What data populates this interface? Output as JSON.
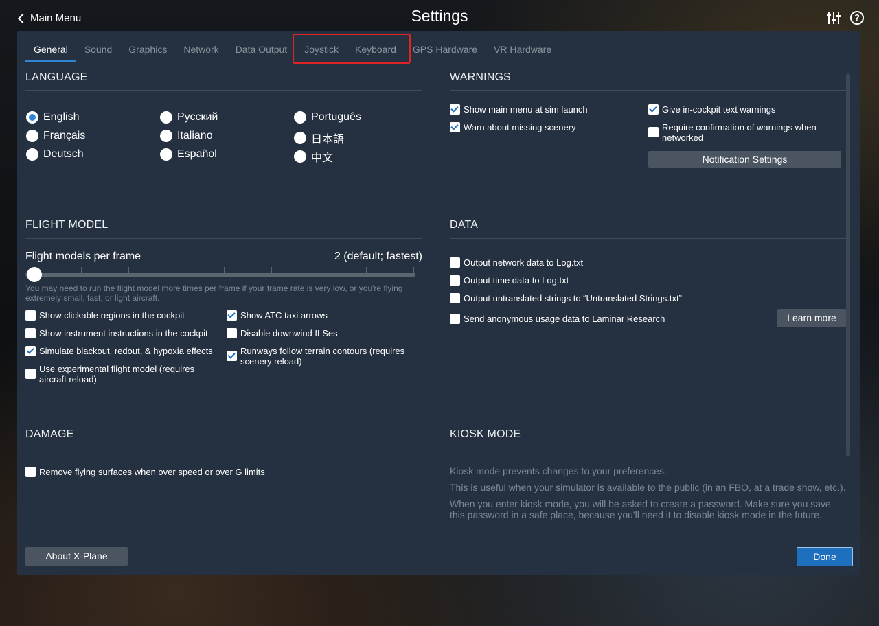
{
  "topbar": {
    "back_label": "Main Menu",
    "title": "Settings"
  },
  "tabs": [
    {
      "label": "General"
    },
    {
      "label": "Sound"
    },
    {
      "label": "Graphics"
    },
    {
      "label": "Network"
    },
    {
      "label": "Data Output"
    },
    {
      "label": "Joystick"
    },
    {
      "label": "Keyboard"
    },
    {
      "label": "GPS Hardware"
    },
    {
      "label": "VR Hardware"
    }
  ],
  "language": {
    "title": "LANGUAGE",
    "options": [
      "English",
      "Français",
      "Deutsch",
      "Русский",
      "Italiano",
      "Español",
      "Português",
      "日本語",
      "中文"
    ],
    "selected": "English"
  },
  "warnings": {
    "title": "WARNINGS",
    "items": [
      {
        "label": "Show main menu at sim launch",
        "checked": true
      },
      {
        "label": "Warn about missing scenery",
        "checked": true
      },
      {
        "label": "Give in-cockpit text warnings",
        "checked": true
      },
      {
        "label": "Require confirmation of warnings when networked",
        "checked": false
      }
    ],
    "notification_button": "Notification Settings"
  },
  "flight_model": {
    "title": "FLIGHT MODEL",
    "slider_label": "Flight models per frame",
    "slider_value": "2 (default; fastest)",
    "slider_level": 0,
    "help": "You may need to run the flight model more times per frame if your frame rate is very low, or you're flying extremely small, fast, or light aircraft.",
    "items": [
      {
        "label": "Show clickable regions in the cockpit",
        "checked": false
      },
      {
        "label": "Show instrument instructions in the cockpit",
        "checked": false
      },
      {
        "label": "Simulate blackout, redout, & hypoxia effects",
        "checked": true
      },
      {
        "label": "Use experimental flight model (requires aircraft reload)",
        "checked": false
      },
      {
        "label": "Show ATC taxi arrows",
        "checked": true
      },
      {
        "label": "Disable downwind ILSes",
        "checked": false
      },
      {
        "label": "Runways follow terrain contours (requires scenery reload)",
        "checked": true
      }
    ]
  },
  "data": {
    "title": "DATA",
    "items": [
      {
        "label": "Output network data to Log.txt",
        "checked": false
      },
      {
        "label": "Output time data to Log.txt",
        "checked": false
      },
      {
        "label": "Output untranslated strings to “Untranslated Strings.txt”",
        "checked": false
      },
      {
        "label": "Send anonymous usage data to Laminar Research",
        "checked": false
      }
    ],
    "learn_more": "Learn more"
  },
  "damage": {
    "title": "DAMAGE",
    "items": [
      {
        "label": "Remove flying surfaces when over speed or over G limits",
        "checked": false
      }
    ]
  },
  "kiosk": {
    "title": "KIOSK MODE",
    "lines": [
      "Kiosk mode prevents changes to your preferences.",
      "This is useful when your simulator is available to the public (in an FBO, at a trade show, etc.).",
      "When you enter kiosk mode, you will be asked to create a password. Make sure you save this password in a safe place, because you'll need it to disable kiosk mode in the future."
    ]
  },
  "footer": {
    "about": "About X-Plane",
    "done": "Done"
  },
  "colors": {
    "panel": "#253140",
    "accent": "#2f86d6",
    "highlight": "#e02424"
  }
}
